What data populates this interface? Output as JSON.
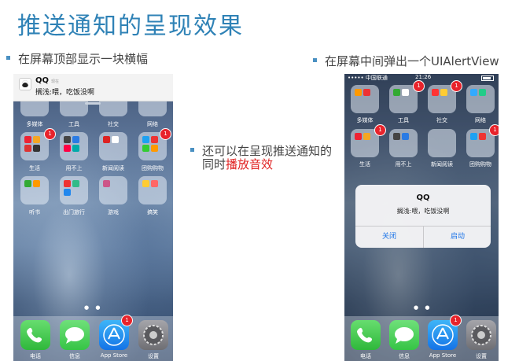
{
  "title": "推送通知的呈现效果",
  "bullets": {
    "left": "在屏幕顶部显示一块横幅",
    "right": "在屏幕中间弹出一个UIAlertView",
    "middle_prefix": "还可以在呈现推送通知的同时",
    "middle_highlight": "播放音效"
  },
  "banner": {
    "app": "QQ",
    "tag": "现在",
    "message": "搁浅:喂，吃饭没啊"
  },
  "alert": {
    "title": "QQ",
    "message": "搁浅:喂，吃饭没啊",
    "close": "关闭",
    "launch": "启动"
  },
  "status": {
    "carrier": "••••• 中国联通 ",
    "time": "21:26"
  },
  "home1": {
    "row1": [
      "多媒体",
      "工具",
      "社交",
      "网络"
    ],
    "row2": [
      "生活",
      "用不上",
      "新闻阅读",
      "团购购物"
    ],
    "row3": [
      "听书",
      "出门旅行",
      "游戏",
      "搞笑"
    ],
    "badge": "1"
  },
  "home2": {
    "row1": [
      "多媒体",
      "工具",
      "社交",
      "网络"
    ],
    "row2": [
      "生活",
      "用不上",
      "新闻阅读",
      "团购购物"
    ],
    "badge": "1"
  },
  "dock": [
    "电话",
    "信息",
    "App Store",
    "设置"
  ],
  "dock_badge": "1",
  "page_dots": "● ●",
  "colors": {
    "title": "#2f82b6",
    "accent_red": "#e02020",
    "badge": "#e8232b",
    "phone": "#3ec34a",
    "appstore": "#1e8fe6",
    "settings": "#8e8e93"
  }
}
